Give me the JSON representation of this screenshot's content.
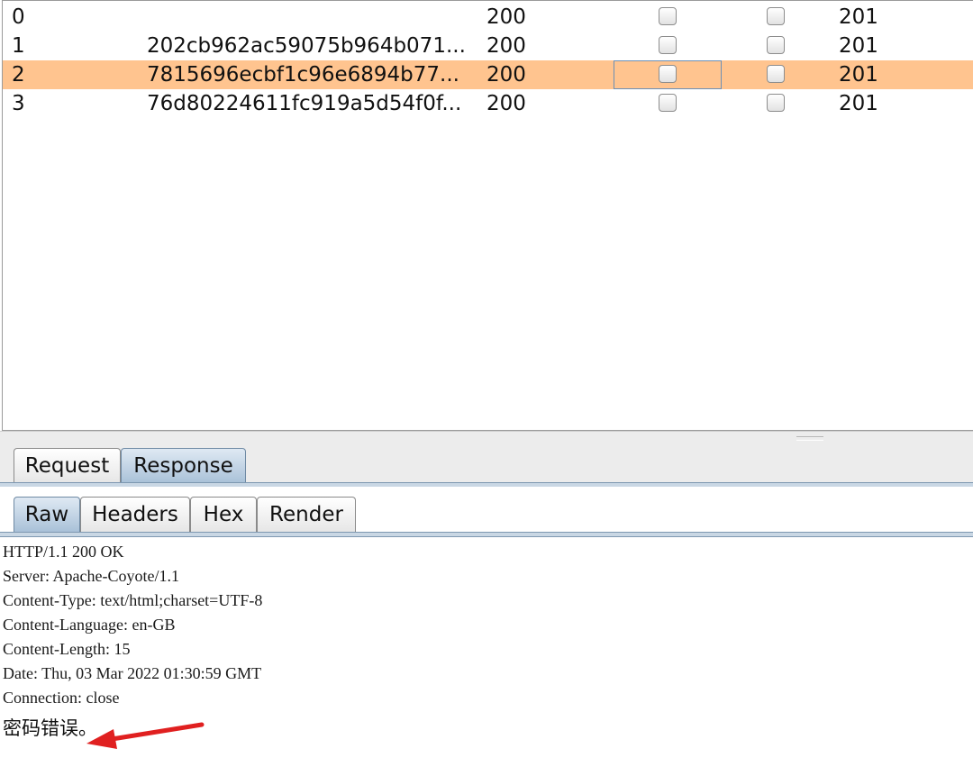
{
  "results_table": {
    "rows": [
      {
        "num": "0",
        "payload": "",
        "status": "200",
        "length": "201",
        "selected": false
      },
      {
        "num": "1",
        "payload": "202cb962ac59075b964b071...",
        "status": "200",
        "length": "201",
        "selected": false
      },
      {
        "num": "2",
        "payload": "7815696ecbf1c96e6894b77...",
        "status": "200",
        "length": "201",
        "selected": true
      },
      {
        "num": "3",
        "payload": "76d80224611fc919a5d54f0f...",
        "status": "200",
        "length": "201",
        "selected": false
      }
    ]
  },
  "message_tabs": [
    {
      "label": "Request",
      "active": false
    },
    {
      "label": "Response",
      "active": true
    }
  ],
  "view_tabs": [
    {
      "label": "Raw",
      "active": true
    },
    {
      "label": "Headers",
      "active": false
    },
    {
      "label": "Hex",
      "active": false
    },
    {
      "label": "Render",
      "active": false
    }
  ],
  "response": {
    "headers": [
      "HTTP/1.1 200 OK",
      "Server: Apache-Coyote/1.1",
      "Content-Type: text/html;charset=UTF-8",
      "Content-Language: en-GB",
      "Content-Length: 15",
      "Date: Thu, 03 Mar 2022 01:30:59 GMT",
      "Connection: close"
    ],
    "body": "密码错误。"
  },
  "colors": {
    "selected_row": "#ffc48f",
    "active_tab": "#a9c1d8",
    "arrow": "#e02020"
  }
}
